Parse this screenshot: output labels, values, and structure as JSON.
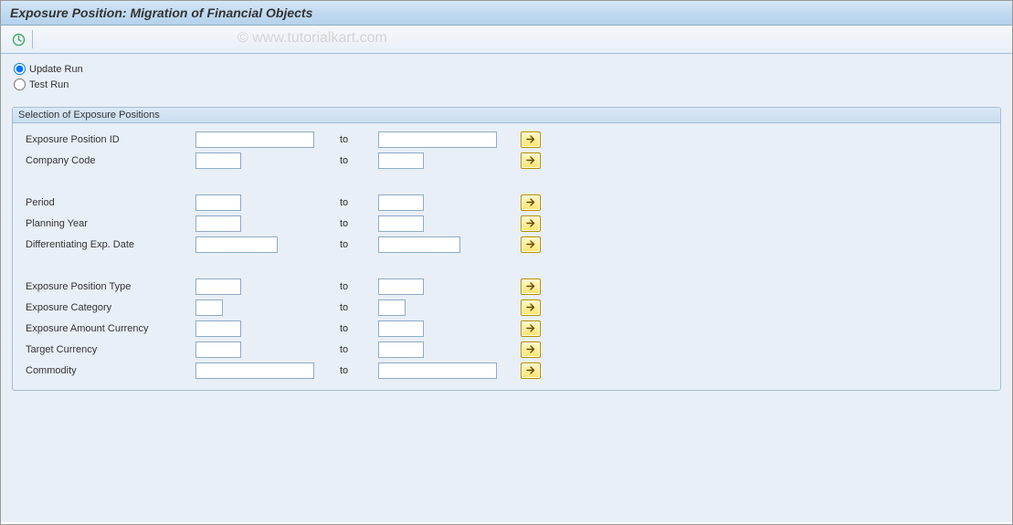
{
  "title": "Exposure Position: Migration of Financial Objects",
  "watermark": "© www.tutorialkart.com",
  "radio": {
    "update": "Update Run",
    "test": "Test Run"
  },
  "group": {
    "header": "Selection of Exposure Positions",
    "to_label": "to",
    "rows": {
      "exp_pos_id": "Exposure Position ID",
      "company_code": "Company Code",
      "period": "Period",
      "planning_year": "Planning Year",
      "diff_exp_date": "Differentiating Exp. Date",
      "exp_pos_type": "Exposure Position Type",
      "exp_category": "Exposure Category",
      "exp_amt_curr": "Exposure Amount Currency",
      "target_curr": "Target Currency",
      "commodity": "Commodity"
    }
  },
  "values": {
    "exp_pos_id_from": "",
    "exp_pos_id_to": "",
    "company_code_from": "",
    "company_code_to": "",
    "period_from": "",
    "period_to": "",
    "planning_year_from": "",
    "planning_year_to": "",
    "diff_exp_date_from": "",
    "diff_exp_date_to": "",
    "exp_pos_type_from": "",
    "exp_pos_type_to": "",
    "exp_category_from": "",
    "exp_category_to": "",
    "exp_amt_curr_from": "",
    "exp_amt_curr_to": "",
    "target_curr_from": "",
    "target_curr_to": "",
    "commodity_from": "",
    "commodity_to": ""
  }
}
